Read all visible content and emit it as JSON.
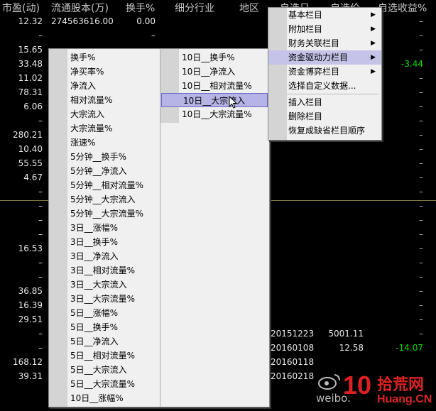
{
  "header": {
    "pe": "市盈(动)",
    "float_shares": "流通股本(万)",
    "turnover": "换手%",
    "industry": "细分行业",
    "region": "地区",
    "sel_date": "自选日",
    "sel_price": "自选价",
    "sel_return": "自选收益%"
  },
  "rows": [
    {
      "pe": "12.32",
      "fs": "274563616.00",
      "turn": "0.00",
      "ret": "–"
    },
    {
      "pe": "–",
      "fs": "",
      "turn": "–",
      "ret": "–"
    },
    {
      "pe": "15.65",
      "fs": "",
      "turn": "",
      "ret": "–"
    },
    {
      "pe": "33.48",
      "fs": "",
      "turn": "",
      "ret": "-3.44"
    },
    {
      "pe": "11.02",
      "fs": "",
      "turn": "",
      "ret": "–"
    },
    {
      "pe": "78.31",
      "fs": "",
      "turn": "",
      "ret": "–"
    },
    {
      "pe": "6.06",
      "fs": "",
      "turn": "",
      "ret": "–"
    },
    {
      "pe": "–",
      "fs": "",
      "turn": "",
      "ret": "–"
    },
    {
      "pe": "280.21",
      "fs": "",
      "turn": "",
      "ret": "–"
    },
    {
      "pe": "10.40",
      "fs": "",
      "turn": "",
      "ret": "–"
    },
    {
      "pe": "55.55",
      "fs": "",
      "turn": "",
      "ret": "–"
    },
    {
      "pe": "4.67",
      "fs": "",
      "turn": "",
      "ret": "–"
    },
    {
      "pe": "–",
      "fs": "",
      "turn": "",
      "ret": "–"
    },
    {
      "pe": "–",
      "fs": "",
      "turn": "",
      "ret": "–"
    },
    {
      "pe": "–",
      "fs": "",
      "turn": "",
      "ret": "–"
    },
    {
      "pe": "–",
      "fs": "",
      "turn": "",
      "ret": "–"
    },
    {
      "pe": "16.53",
      "fs": "",
      "turn": "",
      "ret": "–"
    },
    {
      "pe": "–",
      "fs": "",
      "turn": "",
      "ret": "–"
    },
    {
      "pe": "–",
      "fs": "",
      "turn": "",
      "ret": "–"
    },
    {
      "pe": "36.85",
      "fs": "",
      "turn": "",
      "ret": "–"
    },
    {
      "pe": "16.39",
      "fs": "",
      "turn": "",
      "ret": "–"
    },
    {
      "pe": "29.51",
      "fs": "",
      "turn": "",
      "ret": "–"
    },
    {
      "pe": "–",
      "fs": "",
      "turn": "",
      "ret": "–",
      "date": "20151223",
      "price": "5001.11"
    },
    {
      "pe": "–",
      "fs": "",
      "turn": "",
      "ret": "-14.07",
      "date": "20160108",
      "price": "12.58"
    },
    {
      "pe": "168.12",
      "fs": "",
      "turn": "",
      "ret": "",
      "date": "20160118",
      "price": ""
    },
    {
      "pe": "39.31",
      "fs": "",
      "turn": "",
      "ret": "",
      "date": "20160218",
      "price": ""
    }
  ],
  "context_menu": {
    "items": [
      {
        "label": "基本栏目",
        "submenu": true
      },
      {
        "label": "附加栏目",
        "submenu": true
      },
      {
        "label": "财务关联栏目",
        "submenu": true
      },
      {
        "label": "资金驱动力栏目",
        "submenu": true,
        "active": true
      },
      {
        "label": "资金博弈栏目",
        "submenu": true
      },
      {
        "label": "选择自定义数据..."
      },
      {
        "label": "插入栏目"
      },
      {
        "label": "删除栏目"
      },
      {
        "label": "恢复成缺省栏目顺序"
      }
    ]
  },
  "submenu_left": {
    "items": [
      "换手%",
      "净买率%",
      "净流入",
      "相对流量%",
      "大宗流入",
      "大宗流量%",
      "涨速%",
      "5分钟__换手%",
      "5分钟__净流入",
      "5分钟__相对流量%",
      "5分钟__大宗流入",
      "5分钟__大宗流量%",
      "3日__涨幅%",
      "3日__换手%",
      "3日__净流入",
      "3日__相对流量%",
      "3日__大宗流入",
      "3日__大宗流量%",
      "5日__涨幅%",
      "5日__换手%",
      "5日__净流入",
      "5日__相对流量%",
      "5日__大宗流入",
      "5日__大宗流量%",
      "10日__涨幅%"
    ]
  },
  "submenu_right": {
    "items": [
      "10日__换手%",
      "10日__净流入",
      "10日__相对流量%",
      "10日__大宗流入",
      "10日__大宗流量%"
    ],
    "highlighted_index": 3
  },
  "watermark": {
    "weibo": "weibo.",
    "logo_number": "10",
    "logo_text": "拾荒网",
    "logo_domain": "Huang.CN"
  },
  "colors": {
    "positive": "#ff3333",
    "negative": "#00e000",
    "menu_bg": "#f0f0f0",
    "highlight": "#b6b4e6"
  }
}
